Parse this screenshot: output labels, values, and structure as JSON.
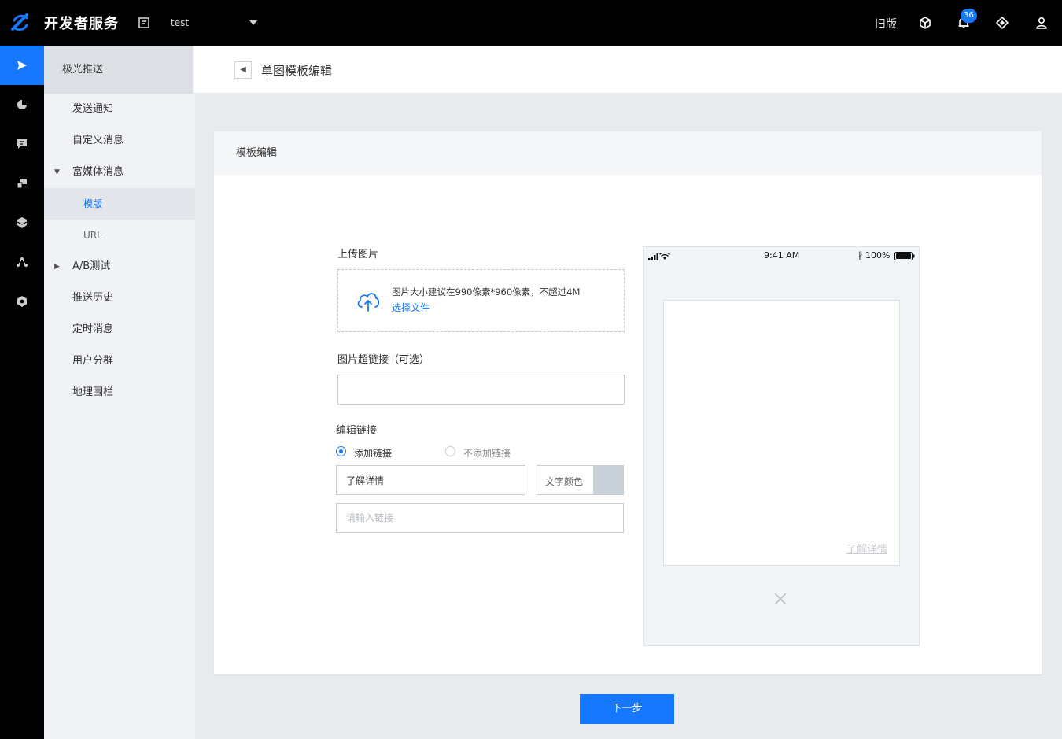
{
  "topbar": {
    "brand": "开发者服务",
    "app_name": "test",
    "old_version": "旧版",
    "notification_count": "36"
  },
  "rail": {
    "icons": [
      "push-icon",
      "analytics-icon",
      "message-icon",
      "devices-icon",
      "shield-icon",
      "share-icon",
      "settings-icon"
    ]
  },
  "subnav": {
    "header": "极光推送",
    "items": [
      {
        "label": "发送通知"
      },
      {
        "label": "自定义消息"
      },
      {
        "label": "富媒体消息"
      },
      {
        "label": "模版"
      },
      {
        "label": "URL"
      },
      {
        "label": "A/B测试"
      },
      {
        "label": "推送历史"
      },
      {
        "label": "定时消息"
      },
      {
        "label": "用户分群"
      },
      {
        "label": "地理围栏"
      }
    ]
  },
  "page": {
    "title": "单图模板编辑"
  },
  "card": {
    "title": "模板编辑",
    "upload": {
      "label": "上传图片",
      "hint": "图片大小建议在990像素*960像素，不超过4M",
      "link": "选择文件"
    },
    "image_link": {
      "label": "图片超链接（可选）",
      "value": ""
    },
    "edit_link": {
      "label": "编辑链接",
      "option_add": "添加链接",
      "option_none": "不添加链接",
      "selected": "添加链接",
      "text_value": "了解详情",
      "color_label": "文字颜色",
      "color_value": "#c8d0d8",
      "url_placeholder": "请输入链接"
    }
  },
  "preview": {
    "time": "9:41 AM",
    "battery": "100%",
    "link_text": "了解详情"
  },
  "footer": {
    "next_label": "下一步"
  },
  "colors": {
    "accent": "#1677ff",
    "topbar": "#000000"
  }
}
